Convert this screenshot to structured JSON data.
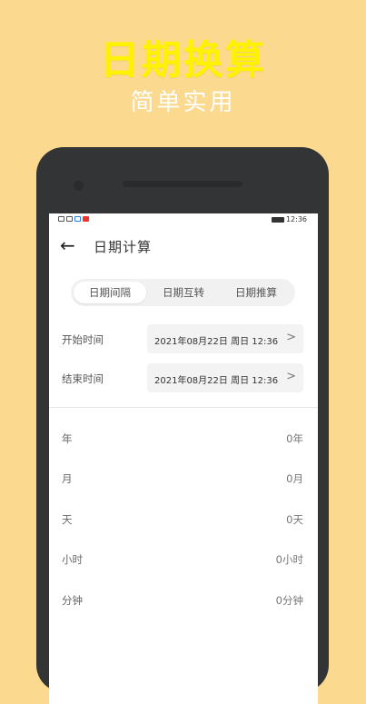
{
  "promo": {
    "title": "日期换算",
    "subtitle": "简单实用"
  },
  "statusbar": {
    "time": "12:36"
  },
  "header": {
    "back_icon": "←",
    "title": "日期计算"
  },
  "tabs": [
    {
      "label": "日期间隔",
      "active": true
    },
    {
      "label": "日期互转",
      "active": false
    },
    {
      "label": "日期推算",
      "active": false
    }
  ],
  "form": {
    "start": {
      "label": "开始时间",
      "value": "2021年08月22日 周日 12:36",
      "chevron": ">"
    },
    "end": {
      "label": "结束时间",
      "value": "2021年08月22日 周日 12:36",
      "chevron": ">"
    }
  },
  "results": [
    {
      "label": "年",
      "value": "0年"
    },
    {
      "label": "月",
      "value": "0月"
    },
    {
      "label": "天",
      "value": "0天"
    },
    {
      "label": "小时",
      "value": "0小时"
    },
    {
      "label": "分钟",
      "value": "0分钟"
    }
  ],
  "colors": {
    "background": "#fbd98e",
    "title": "#fff200",
    "phone": "#333436"
  }
}
